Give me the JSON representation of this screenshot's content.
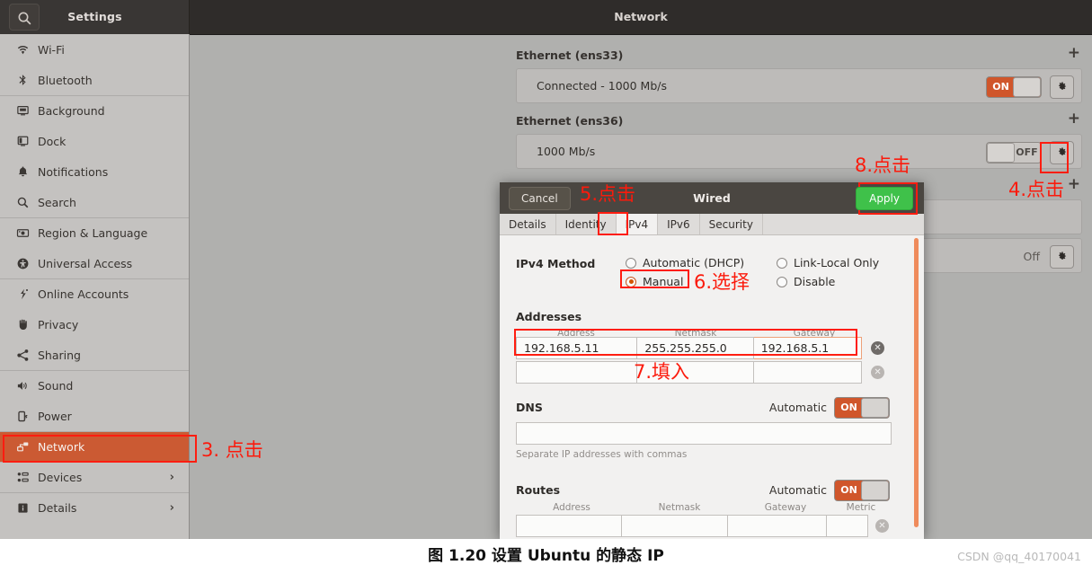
{
  "header": {
    "search_icon": "search-icon",
    "left_title": "Settings",
    "right_title": "Network"
  },
  "sidebar": {
    "items": [
      {
        "label": "Wi-Fi",
        "icon": "wifi-icon",
        "active": false,
        "chevron": ""
      },
      {
        "label": "Bluetooth",
        "icon": "bluetooth-icon",
        "active": false,
        "chevron": ""
      },
      {
        "label": "Background",
        "icon": "background-icon",
        "active": false,
        "chevron": ""
      },
      {
        "label": "Dock",
        "icon": "dock-icon",
        "active": false,
        "chevron": ""
      },
      {
        "label": "Notifications",
        "icon": "bell-icon",
        "active": false,
        "chevron": ""
      },
      {
        "label": "Search",
        "icon": "search-icon",
        "active": false,
        "chevron": ""
      },
      {
        "label": "Region & Language",
        "icon": "region-language-icon",
        "active": false,
        "chevron": ""
      },
      {
        "label": "Universal Access",
        "icon": "universal-access-icon",
        "active": false,
        "chevron": ""
      },
      {
        "label": "Online Accounts",
        "icon": "online-accounts-icon",
        "active": false,
        "chevron": ""
      },
      {
        "label": "Privacy",
        "icon": "privacy-hand-icon",
        "active": false,
        "chevron": ""
      },
      {
        "label": "Sharing",
        "icon": "sharing-icon",
        "active": false,
        "chevron": ""
      },
      {
        "label": "Sound",
        "icon": "sound-icon",
        "active": false,
        "chevron": ""
      },
      {
        "label": "Power",
        "icon": "power-icon",
        "active": false,
        "chevron": ""
      },
      {
        "label": "Network",
        "icon": "network-icon",
        "active": true,
        "chevron": ""
      },
      {
        "label": "Devices",
        "icon": "devices-icon",
        "active": false,
        "chevron": "›"
      },
      {
        "label": "Details",
        "icon": "details-info-icon",
        "active": false,
        "chevron": "›"
      }
    ]
  },
  "network_panel": {
    "sections": [
      {
        "title": "Ethernet (ens33)",
        "add_label": "+",
        "row_label": "Connected - 1000 Mb/s",
        "toggle_state": "ON",
        "toggle_on": true,
        "gear_icon": "gear-icon"
      },
      {
        "title": "Ethernet (ens36)",
        "add_label": "+",
        "row_label": "1000 Mb/s",
        "toggle_state": "OFF",
        "toggle_on": false,
        "gear_icon": "gear-icon"
      }
    ],
    "hidden_section": {
      "add_label": "+",
      "off_label": "Off",
      "gear_icon": "gear-icon"
    }
  },
  "dialog": {
    "cancel_label": "Cancel",
    "title": "Wired",
    "apply_label": "Apply",
    "tabs": [
      {
        "label": "Details",
        "active": false
      },
      {
        "label": "Identity",
        "active": false
      },
      {
        "label": "IPv4",
        "active": true
      },
      {
        "label": "IPv6",
        "active": false
      },
      {
        "label": "Security",
        "active": false
      }
    ],
    "ipv4": {
      "method_label": "IPv4 Method",
      "options": [
        {
          "label": "Automatic (DHCP)",
          "selected": false
        },
        {
          "label": "Manual",
          "selected": true
        },
        {
          "label": "Link-Local Only",
          "selected": false
        },
        {
          "label": "Disable",
          "selected": false
        }
      ]
    },
    "addresses": {
      "title": "Addresses",
      "columns": [
        "Address",
        "Netmask",
        "Gateway"
      ],
      "rows": [
        {
          "address": "192.168.5.11",
          "netmask": "255.255.255.0",
          "gateway": "192.168.5.1",
          "focused": true,
          "clear_icon": "clear-icon"
        },
        {
          "address": "",
          "netmask": "",
          "gateway": "",
          "focused": false,
          "clear_icon": "clear-icon"
        }
      ]
    },
    "dns": {
      "title": "DNS",
      "automatic_label": "Automatic",
      "toggle_state": "ON",
      "value": "",
      "hint": "Separate IP addresses with commas"
    },
    "routes": {
      "title": "Routes",
      "automatic_label": "Automatic",
      "toggle_state": "ON",
      "columns": [
        "Address",
        "Netmask",
        "Gateway",
        "Metric"
      ],
      "row": {
        "address": "",
        "netmask": "",
        "gateway": "",
        "metric": "",
        "clear_icon": "clear-icon"
      }
    }
  },
  "annotations": [
    {
      "id": "step3",
      "text": "3. 点击"
    },
    {
      "id": "step4",
      "text": "4.点击"
    },
    {
      "id": "step5",
      "text": "5.点击"
    },
    {
      "id": "step6",
      "text": "6.选择"
    },
    {
      "id": "step7",
      "text": "7.填入"
    },
    {
      "id": "step8",
      "text": "8.点击"
    }
  ],
  "caption": {
    "text": "图 1.20 设置 Ubuntu 的静态 IP",
    "watermark": "CSDN @qq_40170041"
  },
  "colors": {
    "accent_orange": "#cb5a33",
    "toggle_on": "#d0562b",
    "apply_green": "#3fc14a",
    "annotation_red": "#fb1a0c",
    "scrollbar": "#ef8b5c"
  }
}
